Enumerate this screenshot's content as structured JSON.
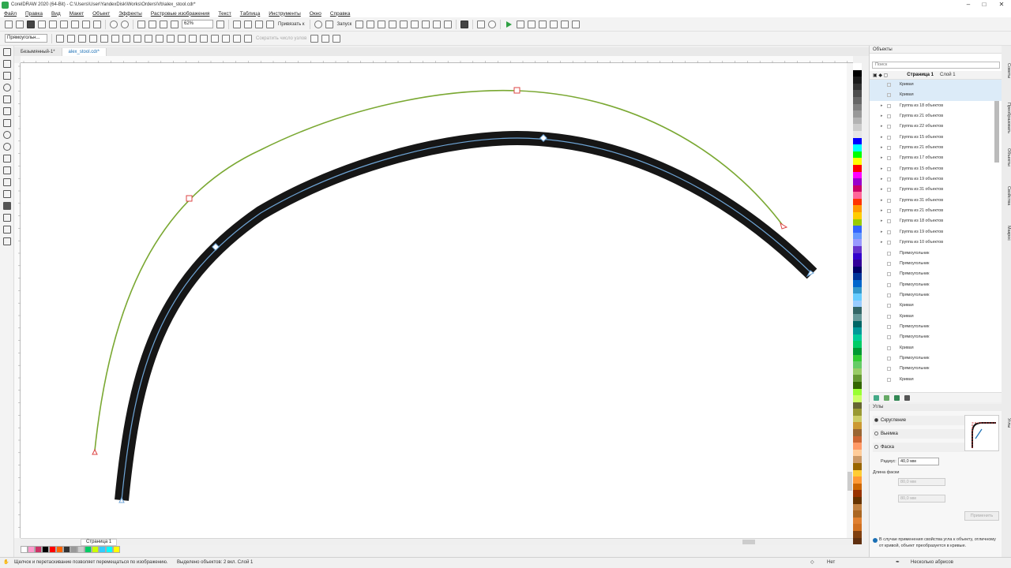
{
  "window": {
    "title": "CorelDRAW 2020 (64-Bit) - C:\\Users\\User\\YandexDisk\\Works\\Orders\\Vb\\alex_stool.cdr*",
    "minimize": "–",
    "maximize": "□",
    "close": "✕"
  },
  "menu": [
    "Файл",
    "Правка",
    "Вид",
    "Макет",
    "Объект",
    "Эффекты",
    "Растровые изображения",
    "Текст",
    "Таблица",
    "Инструменты",
    "Окно",
    "Справка"
  ],
  "toolbar": {
    "zoom": "62%",
    "snap_label": "Привязать к",
    "launch_label": "Запуск"
  },
  "propertybar": {
    "object_type": "Прямоугольн...",
    "reduce_nodes": "Сократить число узлов"
  },
  "doc_tabs": [
    "Безымянный-1*",
    "alex_stool.cdr*"
  ],
  "page_tab": "Страница 1",
  "objects_docker": {
    "title": "Объекты",
    "search_placeholder": "Поиск",
    "page": "Страница 1",
    "layer": "Слой 1",
    "rows": [
      {
        "label": "Кривая",
        "selected": true
      },
      {
        "label": "Кривая",
        "selected": true
      },
      {
        "label": "Группа из 18 объектов",
        "group": true
      },
      {
        "label": "Группа из 21 объектов",
        "group": true
      },
      {
        "label": "Группа из 22 объектов",
        "group": true
      },
      {
        "label": "Группа из 15 объектов",
        "group": true
      },
      {
        "label": "Группа из 21 объектов",
        "group": true
      },
      {
        "label": "Группа из 17 объектов",
        "group": true
      },
      {
        "label": "Группа из 15 объектов",
        "group": true
      },
      {
        "label": "Группа из 19 объектов",
        "group": true
      },
      {
        "label": "Группа из 31 объектов",
        "group": true
      },
      {
        "label": "Группа из 31 объектов",
        "group": true
      },
      {
        "label": "Группа из 21 объектов",
        "group": true
      },
      {
        "label": "Группа из 18 объектов",
        "group": true
      },
      {
        "label": "Группа из 19 объектов",
        "group": true
      },
      {
        "label": "Группа из 10 объектов",
        "group": true
      },
      {
        "label": "Прямоугольник"
      },
      {
        "label": "Прямоугольник"
      },
      {
        "label": "Прямоугольник"
      },
      {
        "label": "Прямоугольник"
      },
      {
        "label": "Прямоугольник"
      },
      {
        "label": "Кривая"
      },
      {
        "label": "Кривая"
      },
      {
        "label": "Прямоугольник"
      },
      {
        "label": "Прямоугольник"
      },
      {
        "label": "Кривая"
      },
      {
        "label": "Прямоугольник"
      },
      {
        "label": "Прямоугольник"
      },
      {
        "label": "Кривая"
      }
    ]
  },
  "corners_docker": {
    "title": "Углы",
    "option_round": "Скругление",
    "option_notch": "Выемка",
    "option_chamfer": "Фаска",
    "radius_label": "Радиус:",
    "radius_value": "40,0 мм",
    "chamfer_length_label": "Длина фаски",
    "chamfer_1": "80,0 мм",
    "chamfer_2": "80,0 мм",
    "apply": "Применить",
    "info": "В случае применения свойства угла к объекту, отличному от кривой, объект преобразуется в кривые."
  },
  "side_tabs": [
    "Советы",
    "Преобразовать",
    "Объекты",
    "Свойства",
    "Макрос",
    "Углы"
  ],
  "status": {
    "hint": "Щелчок и перетаскивание позволяет перемещаться по изображению.",
    "selection": "Выделено объектов: 2 вкл. Слой 1",
    "fill": "Нет",
    "outline": "Несколько абрисов"
  },
  "colors": {
    "green_curve": "#7aa832",
    "thick_stroke": "#161616",
    "center_line": "#6fa6d8",
    "accent": "#1a6fb5"
  },
  "right_palette": [
    "#ffffff",
    "#000000",
    "#1a1a1a",
    "#333333",
    "#4d4d4d",
    "#666666",
    "#808080",
    "#999999",
    "#b3b3b3",
    "#cccccc",
    "#e6e6e6",
    "#0000ff",
    "#00ffff",
    "#00ff00",
    "#ffff00",
    "#ff0000",
    "#ff00ff",
    "#9900cc",
    "#cc0066",
    "#ff6699",
    "#ff3300",
    "#ff9900",
    "#ffcc00",
    "#99cc00",
    "#3366ff",
    "#6699ff",
    "#9999ff",
    "#6633cc",
    "#3300cc",
    "#330099",
    "#000066",
    "#003399",
    "#0066cc",
    "#3399cc",
    "#66ccff",
    "#99ccff",
    "#336666",
    "#669999",
    "#006666",
    "#009999",
    "#00cc99",
    "#00cc66",
    "#009933",
    "#33cc33",
    "#66cc66",
    "#99cc66",
    "#669933",
    "#336600",
    "#99ff33",
    "#ccff66",
    "#666633",
    "#999933",
    "#cccc66",
    "#cc9933",
    "#996633",
    "#cc6633",
    "#ff9966",
    "#ffcc99",
    "#cc9966",
    "#996600",
    "#ffcc33",
    "#ff9933",
    "#cc6600",
    "#993300",
    "#663300",
    "#c08040",
    "#aa6622",
    "#e08030",
    "#d07020",
    "#804010",
    "#603010"
  ],
  "bottom_palette": [
    "#ffffff",
    "#ff99cc",
    "#cc3366",
    "#000000",
    "#ff0000",
    "#ff6600",
    "#333333",
    "#999999",
    "#cccccc",
    "#00cc66",
    "#ccff00",
    "#33ccff",
    "#00ffff",
    "#ffff00"
  ]
}
